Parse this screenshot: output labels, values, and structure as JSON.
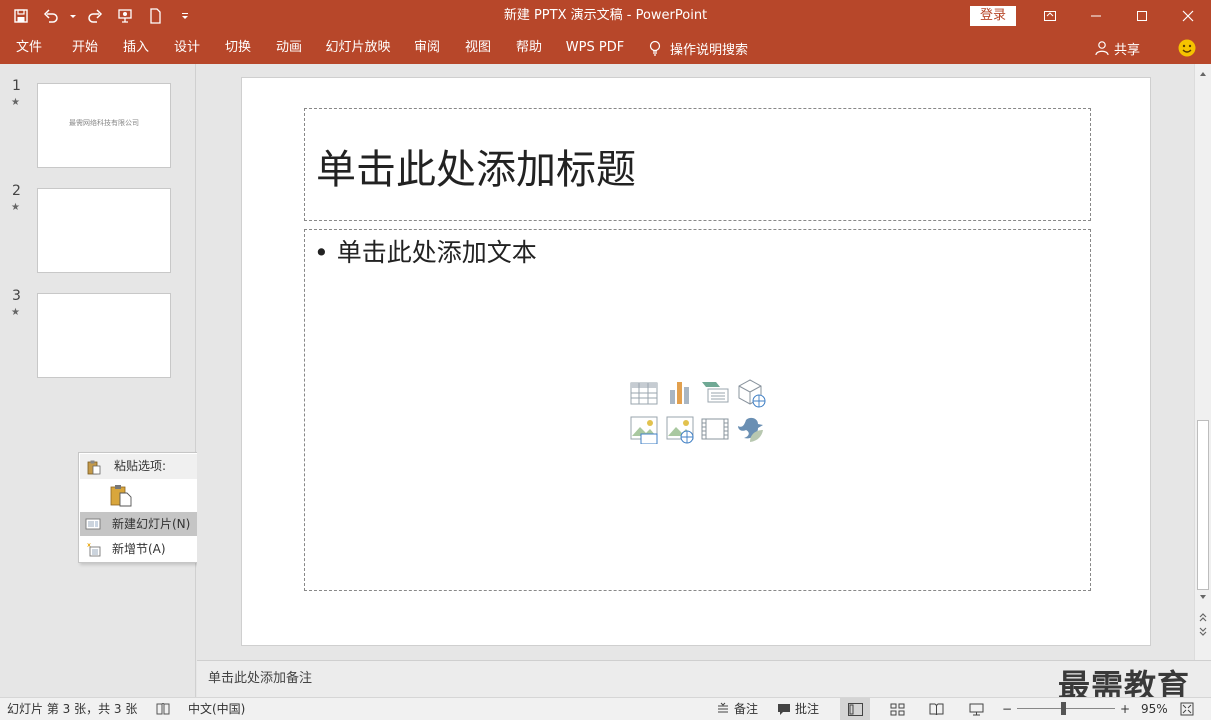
{
  "window": {
    "title": "新建 PPTX 演示文稿 - PowerPoint",
    "login_label": "登录"
  },
  "ribbon": {
    "tabs": [
      {
        "id": "file",
        "label": "文件"
      },
      {
        "id": "home",
        "label": "开始"
      },
      {
        "id": "insert",
        "label": "插入"
      },
      {
        "id": "design",
        "label": "设计"
      },
      {
        "id": "transitions",
        "label": "切换"
      },
      {
        "id": "animations",
        "label": "动画"
      },
      {
        "id": "slideshow",
        "label": "幻灯片放映"
      },
      {
        "id": "review",
        "label": "审阅"
      },
      {
        "id": "view",
        "label": "视图"
      },
      {
        "id": "help",
        "label": "帮助"
      },
      {
        "id": "wpspdf",
        "label": "WPS PDF"
      }
    ],
    "tell_me": "操作说明搜索",
    "share": "共享"
  },
  "thumbnails": [
    {
      "number": "1",
      "star": "★",
      "text": "最需网络科技有限公司"
    },
    {
      "number": "2",
      "star": "★",
      "text": ""
    },
    {
      "number": "3",
      "star": "★",
      "text": ""
    }
  ],
  "context_menu": {
    "header": "粘贴选项:",
    "items": [
      {
        "label": "新建幻灯片(N)"
      },
      {
        "label": "新增节(A)"
      }
    ]
  },
  "slide": {
    "title_placeholder": "单击此处添加标题",
    "body_placeholder": "• 单击此处添加文本"
  },
  "notes": {
    "placeholder": "单击此处添加备注"
  },
  "watermark": "最需教育",
  "status_bar": {
    "slide_info": "幻灯片 第 3 张，共 3 张",
    "language": "中文(中国)",
    "notes_label": "备注",
    "comments_label": "批注",
    "zoom": "95%",
    "zoom_minus": "−",
    "zoom_plus": "+"
  },
  "colors": {
    "accent": "#b7472a",
    "smiley": "#f5c300"
  }
}
